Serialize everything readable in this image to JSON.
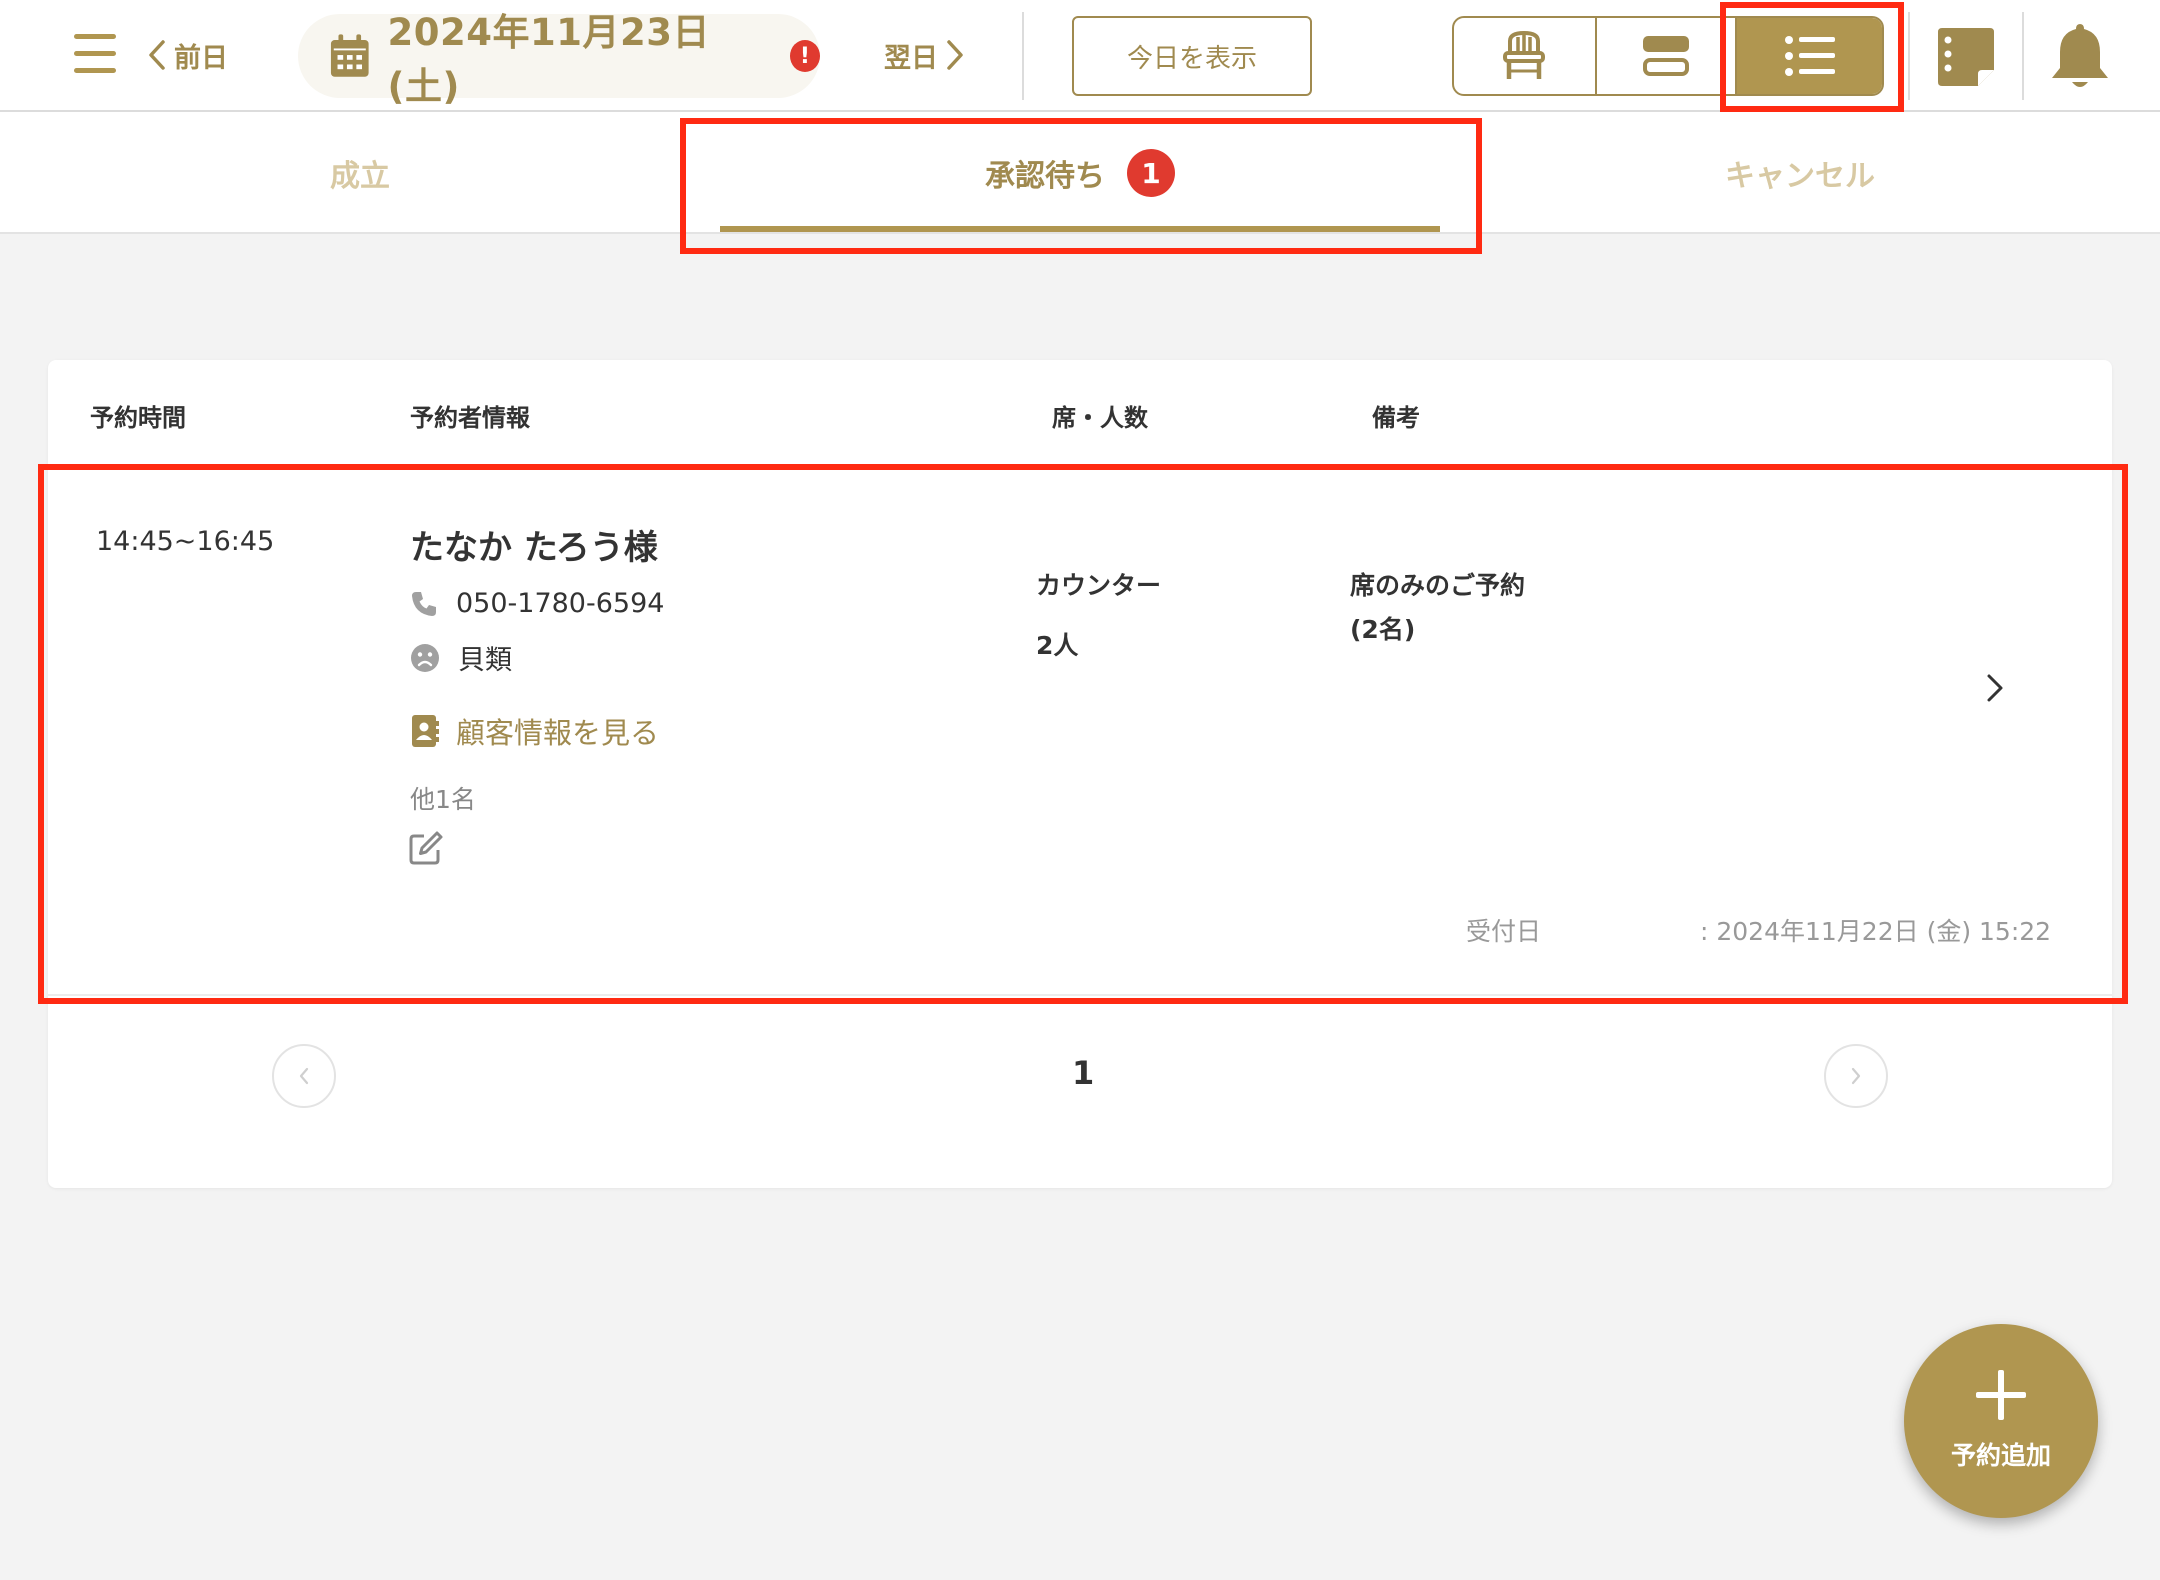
{
  "header": {
    "prev_label": "前日",
    "date": "2024年11月23日 (土)",
    "date_alert": "!",
    "next_label": "翌日",
    "today_label": "今日を表示"
  },
  "tabs": [
    {
      "label": "成立"
    },
    {
      "label": "承認待ち",
      "badge": "1"
    },
    {
      "label": "キャンセル"
    }
  ],
  "table": {
    "headers": [
      "予約時間",
      "予約者情報",
      "席・人数",
      "備考"
    ],
    "rows": [
      {
        "time": "14:45~16:45",
        "name": "たなか たろう様",
        "phone": "050-1780-6594",
        "allergy": "貝類",
        "customer_link": "顧客情報を見る",
        "others": "他1名",
        "seat": "カウンター",
        "party": "2人",
        "note_line1": "席のみのご予約",
        "note_line2": "(2名)",
        "received_label": "受付日",
        "received_value": ": 2024年11月22日 (金) 15:22"
      }
    ]
  },
  "pagination": {
    "current": "1"
  },
  "fab": {
    "label": "予約追加"
  },
  "colors": {
    "accent": "#b09650",
    "accent_text": "#a08a4f",
    "alert": "#e03a2f",
    "highlight": "#ff2a12"
  }
}
